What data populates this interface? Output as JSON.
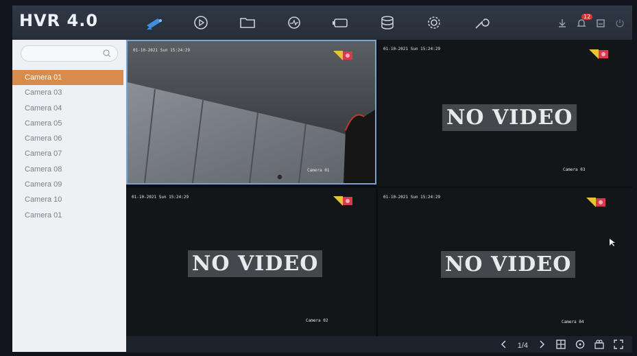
{
  "app": {
    "title": "HVR 4.0"
  },
  "topbar": {
    "nav_icons": [
      "live-view-camera-icon",
      "playback-icon",
      "files-icon",
      "smart-analysis-icon",
      "channel-management-icon",
      "storage-icon",
      "configuration-icon",
      "maintenance-icon"
    ],
    "right_icons": [
      "download-icon",
      "alarm-bell-icon",
      "notifications-icon",
      "power-icon"
    ],
    "alarm_badge": "12"
  },
  "sidebar": {
    "search_placeholder": "",
    "cameras": [
      {
        "label": "Camera 01",
        "active": true
      },
      {
        "label": "Camera 03",
        "active": false
      },
      {
        "label": "Camera 04",
        "active": false
      },
      {
        "label": "Camera 05",
        "active": false
      },
      {
        "label": "Camera 06",
        "active": false
      },
      {
        "label": "Camera 07",
        "active": false
      },
      {
        "label": "Camera 08",
        "active": false
      },
      {
        "label": "Camera 09",
        "active": false
      },
      {
        "label": "Camera 10",
        "active": false
      },
      {
        "label": "Camera 01",
        "active": false
      }
    ]
  },
  "tiles": [
    {
      "timestamp": "01-10-2021 Sun 15:24:29",
      "camera": "Camera 01",
      "has_video": true,
      "message": ""
    },
    {
      "timestamp": "01-10-2021 Sun 15:24:29",
      "camera": "Camera 03",
      "has_video": false,
      "message": "NO VIDEO"
    },
    {
      "timestamp": "01-10-2021 Sun 15:24:29",
      "camera": "Camera 02",
      "has_video": false,
      "message": "NO VIDEO"
    },
    {
      "timestamp": "01-10-2021 Sun 15:24:29",
      "camera": "Camera 04",
      "has_video": false,
      "message": "NO VIDEO"
    }
  ],
  "bottombar": {
    "page": "1/4"
  },
  "colors": {
    "accent": "#d78c4d",
    "selected_border": "#7aa4cf",
    "live_icon": "#3d8fe0"
  }
}
